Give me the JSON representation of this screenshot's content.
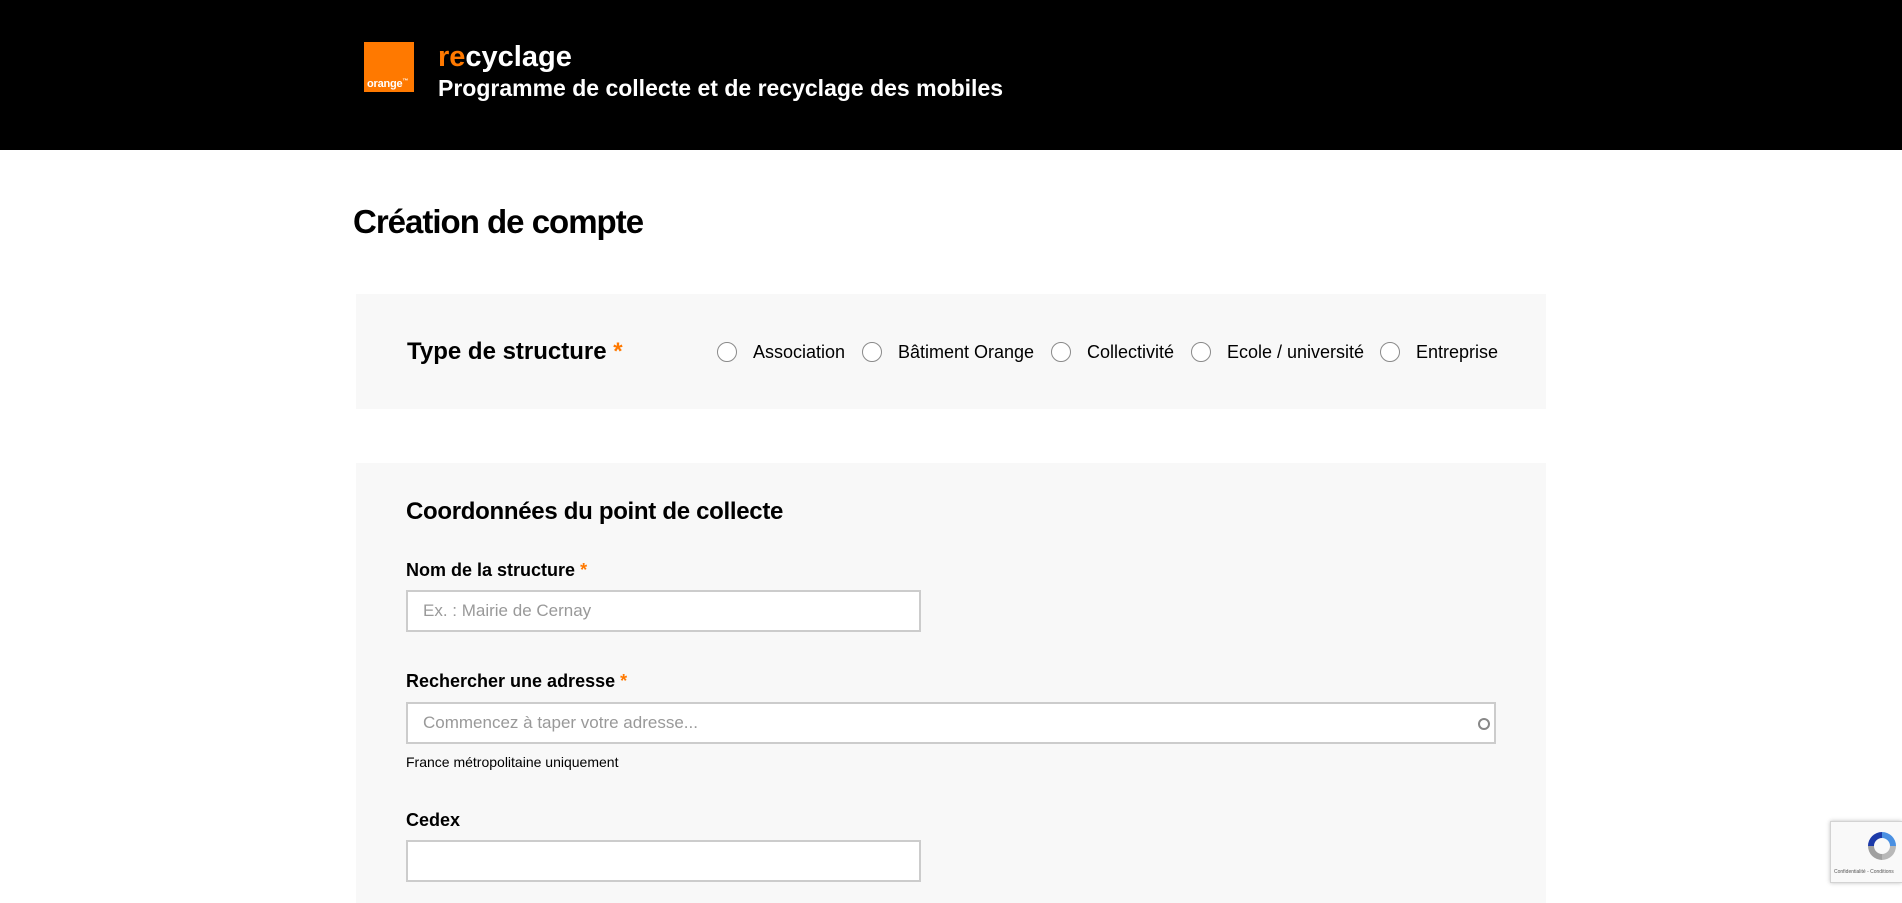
{
  "header": {
    "logo_text": "orange",
    "logo_tm": "™",
    "brand_accent": "re",
    "brand_rest": "cyclage",
    "subtitle": "Programme de collecte et de recyclage des mobiles"
  },
  "page_title": "Création de compte",
  "structure": {
    "label": "Type de structure",
    "required_mark": "*",
    "options": [
      {
        "label": "Association",
        "icon": "radio-unchecked",
        "selected": false
      },
      {
        "label": "Bâtiment Orange",
        "icon": "radio-unchecked",
        "selected": false
      },
      {
        "label": "Collectivité",
        "icon": "radio-unchecked",
        "selected": false
      },
      {
        "label": "Ecole / université",
        "icon": "radio-unchecked",
        "selected": false
      },
      {
        "label": "Entreprise",
        "icon": "radio-unchecked",
        "selected": false
      }
    ]
  },
  "collecte": {
    "title": "Coordonnées du point de collecte",
    "fields": {
      "nom_structure": {
        "label": "Nom de la structure",
        "required_mark": "*",
        "placeholder": "Ex. : Mairie de Cernay",
        "value": ""
      },
      "adresse": {
        "label": "Rechercher une adresse",
        "required_mark": "*",
        "placeholder": "Commencez à taper votre adresse...",
        "value": "",
        "helper": "France métropolitaine uniquement",
        "icon": "loading-spinner-icon"
      },
      "cedex": {
        "label": "Cedex",
        "placeholder": "",
        "value": ""
      }
    }
  },
  "recaptcha": {
    "icon": "recaptcha-icon",
    "text": "Confidentialité - Conditions"
  },
  "colors": {
    "accent": "#ff7900",
    "header_bg": "#000000",
    "panel_bg": "#f8f8f8",
    "input_border": "#cccccc"
  }
}
